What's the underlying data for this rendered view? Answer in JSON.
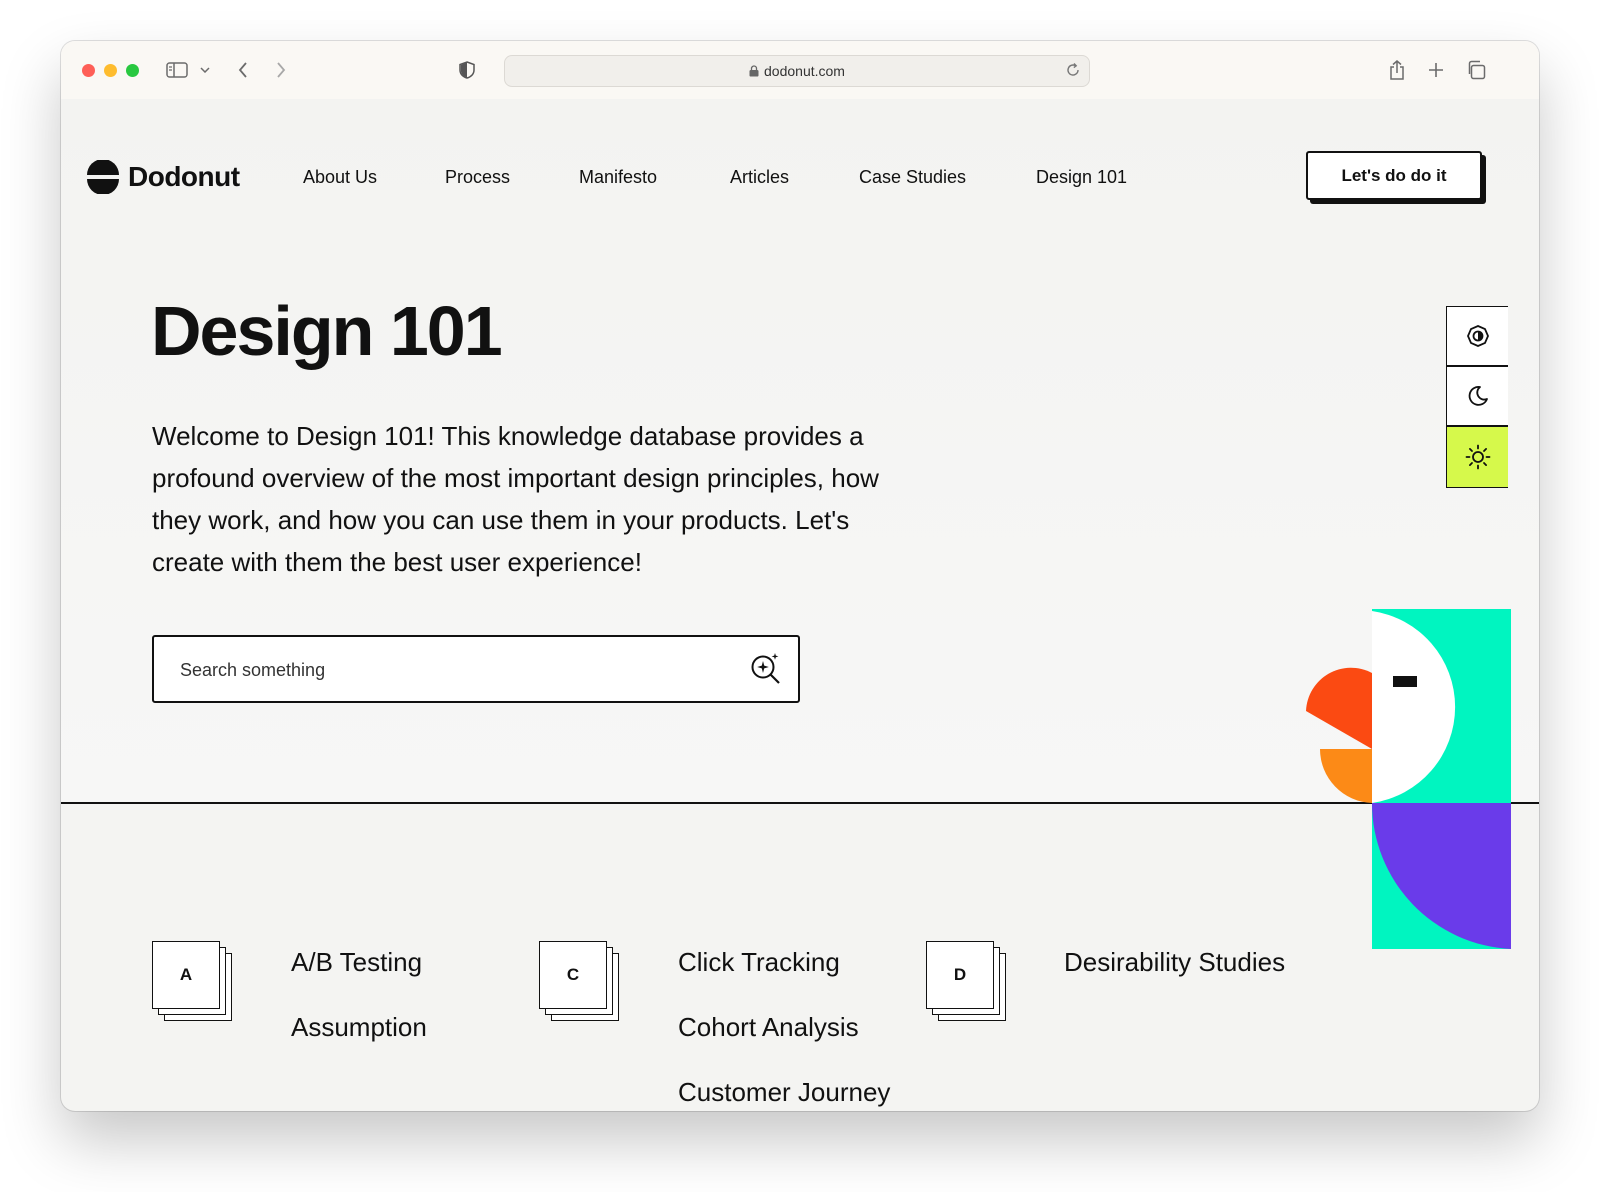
{
  "browser": {
    "url": "dodonut.com"
  },
  "site": {
    "logo_text": "Dodonut",
    "nav": [
      "About Us",
      "Process",
      "Manifesto",
      "Articles",
      "Case Studies",
      "Design 101"
    ],
    "cta_label": "Let's do do it"
  },
  "hero": {
    "title": "Design 101",
    "intro": "Welcome to Design 101! This knowledge database provides a profound overview of the most important design principles, how they work, and how you can use them in your products. Let's create with them the best user experience!",
    "search_placeholder": "Search something"
  },
  "theme_switcher": {
    "options": [
      "auto-theme-icon",
      "moon-icon",
      "sun-icon"
    ],
    "active": "sun-icon",
    "active_color": "#d6f94b"
  },
  "glossary": {
    "groups": [
      {
        "letter": "A",
        "terms": [
          "A/B Testing",
          "Assumption"
        ]
      },
      {
        "letter": "C",
        "terms": [
          "Click Tracking",
          "Cohort Analysis",
          "Customer Journey"
        ]
      },
      {
        "letter": "D",
        "terms": [
          "Desirability Studies"
        ]
      }
    ]
  },
  "colors": {
    "accent_lime": "#d6f94b",
    "bird_teal": "#00f5c0",
    "bird_purple": "#6a3bea",
    "bird_red": "#fb4a12",
    "bird_orange": "#fc8a17",
    "ink": "#111111"
  }
}
